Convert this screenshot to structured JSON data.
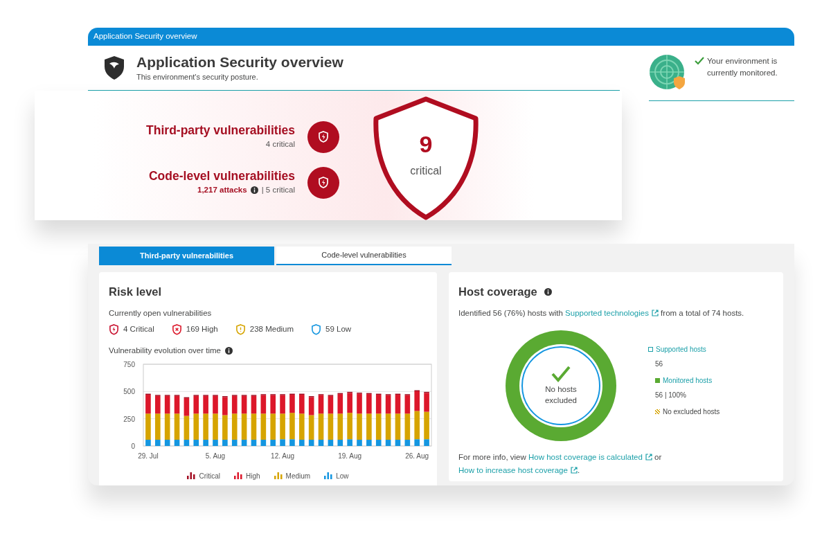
{
  "window": {
    "title": "Application Security overview"
  },
  "header": {
    "title": "Application Security overview",
    "subtitle": "This environment's security posture.",
    "status": "Your environment is currently monitored."
  },
  "summary": {
    "items": [
      {
        "title": "Third-party vulnerabilities",
        "parts": [
          {
            "kind": "text",
            "text": "4 critical"
          }
        ]
      },
      {
        "title": "Code-level vulnerabilities",
        "parts": [
          {
            "kind": "attacks",
            "text": "1,217 attacks"
          },
          {
            "kind": "info"
          },
          {
            "kind": "text",
            "text": "| 5 critical"
          }
        ]
      }
    ],
    "total": "9",
    "total_label": "critical"
  },
  "tabs": [
    {
      "label": "Third-party vulnerabilities",
      "selected": true
    },
    {
      "label": "Code-level vulnerabilities",
      "selected": false
    }
  ],
  "risk": {
    "title": "Risk level",
    "subtitle": "Currently open vulnerabilities",
    "counts": [
      {
        "text": "4 Critical",
        "color": "#c8102e",
        "kind": "critical"
      },
      {
        "text": "169 High",
        "color": "#dc172a",
        "kind": "high"
      },
      {
        "text": "238 Medium",
        "color": "#d6a400",
        "kind": "medium"
      },
      {
        "text": "59 Low",
        "color": "#1496e0",
        "kind": "low"
      }
    ],
    "chart_title": "Vulnerability evolution over time",
    "chart_data": {
      "type": "bar",
      "stacked": true,
      "ylim": [
        0,
        750
      ],
      "yticks": [
        0,
        250,
        500,
        750
      ],
      "categories": [
        "29. Jul",
        null,
        null,
        null,
        null,
        null,
        null,
        "5. Aug",
        null,
        null,
        null,
        null,
        null,
        null,
        "12. Aug",
        null,
        null,
        null,
        null,
        null,
        null,
        "19. Aug",
        null,
        null,
        null,
        null,
        null,
        null,
        "26. Aug",
        null
      ],
      "series": [
        {
          "name": "Low",
          "color": "#1496e0",
          "values": [
            57,
            57,
            57,
            57,
            57,
            57,
            57,
            57,
            57,
            57,
            57,
            57,
            57,
            57,
            62,
            62,
            57,
            57,
            57,
            57,
            57,
            62,
            57,
            57,
            57,
            57,
            57,
            57,
            62,
            62
          ]
        },
        {
          "name": "Medium",
          "color": "#d6a400",
          "values": [
            240,
            240,
            240,
            240,
            219,
            240,
            240,
            240,
            226,
            240,
            240,
            240,
            240,
            240,
            235,
            242,
            240,
            226,
            240,
            240,
            240,
            242,
            240,
            240,
            240,
            240,
            240,
            240,
            259,
            252
          ]
        },
        {
          "name": "High",
          "color": "#dc172a",
          "values": [
            173,
            162,
            162,
            162,
            162,
            162,
            162,
            162,
            165,
            162,
            162,
            162,
            169,
            169,
            169,
            166,
            173,
            165,
            169,
            162,
            179,
            183,
            183,
            179,
            173,
            169,
            173,
            169,
            181,
            173
          ]
        },
        {
          "name": "Critical",
          "color": "#a30d22",
          "values": [
            4,
            4,
            4,
            4,
            4,
            4,
            4,
            4,
            4,
            4,
            4,
            4,
            4,
            4,
            4,
            4,
            4,
            4,
            4,
            4,
            4,
            4,
            4,
            4,
            4,
            4,
            4,
            4,
            4,
            4
          ]
        }
      ]
    }
  },
  "coverage": {
    "title": "Host coverage",
    "intro": [
      {
        "kind": "text",
        "text": "Identified 56 (76%) hosts with "
      },
      {
        "kind": "link",
        "text": "Supported technologies"
      },
      {
        "kind": "text",
        "text": " from a total of 74 hosts."
      }
    ],
    "center": "No hosts excluded",
    "legend": [
      {
        "kind": "outline",
        "label": "Supported hosts",
        "value": "56"
      },
      {
        "kind": "filled",
        "label": "Monitored hosts",
        "value": "56 | 100%"
      },
      {
        "kind": "hatched",
        "label": "No excluded hosts"
      }
    ],
    "footer": [
      {
        "kind": "text",
        "text": "For more info, view "
      },
      {
        "kind": "link",
        "text": "How host coverage is calculated"
      },
      {
        "kind": "text",
        "text": " or "
      },
      {
        "kind": "link",
        "text": "How to increase host coverage"
      },
      {
        "kind": "text",
        "text": "."
      }
    ]
  }
}
